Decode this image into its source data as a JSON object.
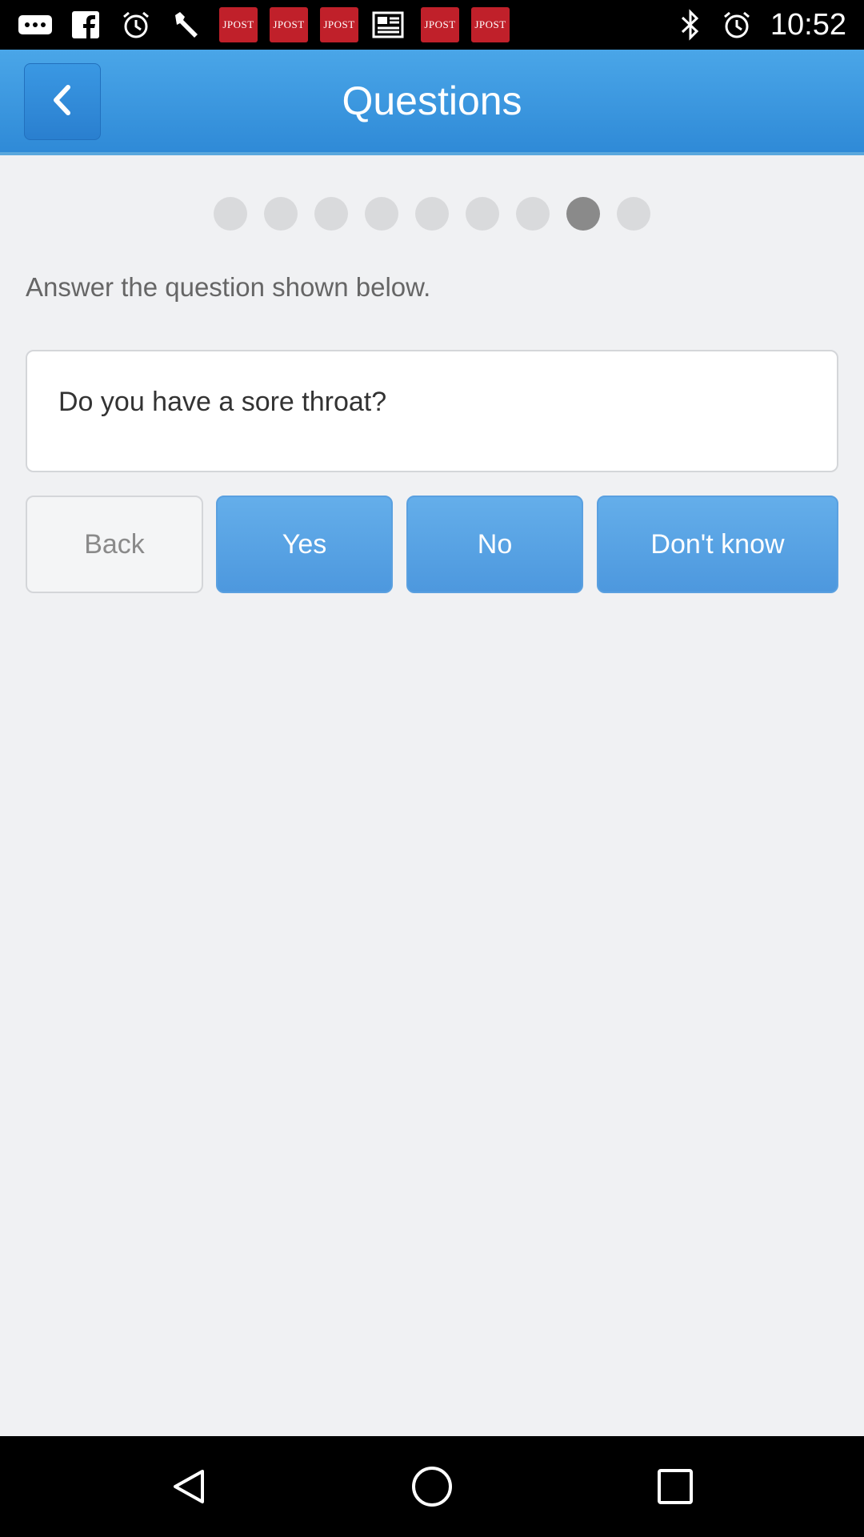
{
  "status_bar": {
    "time": "10:52",
    "notification_icons": [
      "more-icon",
      "facebook-icon",
      "alarm-icon",
      "wrench-icon",
      "jpost-icon",
      "jpost-icon",
      "jpost-icon",
      "news-icon",
      "jpost-icon",
      "jpost-icon"
    ],
    "jpost_label": "JPOST",
    "system_icons": [
      "bluetooth-icon",
      "alarm-icon"
    ]
  },
  "app_bar": {
    "title": "Questions",
    "back_icon": "chevron-left-icon"
  },
  "progress": {
    "total_steps": 9,
    "current_step": 8
  },
  "content": {
    "instruction": "Answer the question shown below.",
    "question": "Do you have a sore throat?"
  },
  "buttons": {
    "back": "Back",
    "yes": "Yes",
    "no": "No",
    "dont_know": "Don't know"
  },
  "colors": {
    "app_bar": "#3d98e0",
    "button_blue": "#5aa3e4",
    "background": "#f0f1f3",
    "dot_inactive": "#d9dadc",
    "dot_active": "#8a8a8a"
  },
  "nav_bar": {
    "icons": [
      "back-triangle-icon",
      "home-circle-icon",
      "recents-square-icon"
    ]
  }
}
